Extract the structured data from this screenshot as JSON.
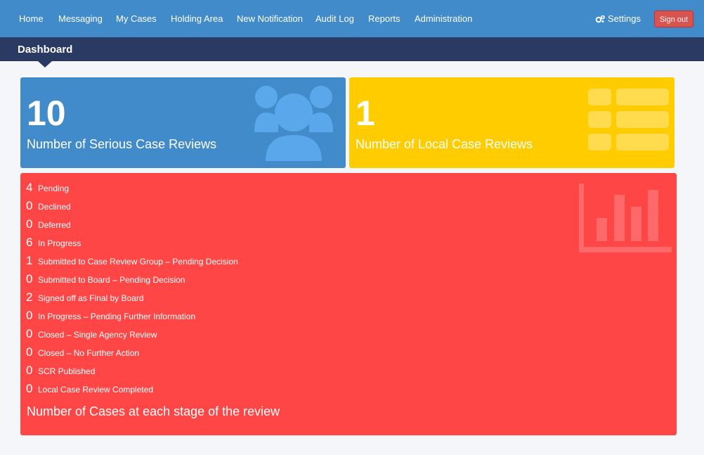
{
  "nav": {
    "items": [
      "Home",
      "Messaging",
      "My Cases",
      "Holding Area",
      "New Notification",
      "Audit Log",
      "Reports",
      "Administration"
    ],
    "settings_label": "Settings",
    "signout_label": "Sign out"
  },
  "header": {
    "title": "Dashboard"
  },
  "cards": {
    "serious": {
      "value": "10",
      "label": "Number of Serious Case Reviews",
      "icon": "users-icon",
      "color": "#428bca"
    },
    "local": {
      "value": "1",
      "label": "Number of Local Case Reviews",
      "icon": "list-icon",
      "color": "#ffcc00"
    }
  },
  "stages": {
    "label": "Number of Cases at each stage of the review",
    "icon": "bar-chart-icon",
    "color": "#ff4646",
    "items": [
      {
        "count": "4",
        "label": "Pending"
      },
      {
        "count": "0",
        "label": "Declined"
      },
      {
        "count": "0",
        "label": "Deferred"
      },
      {
        "count": "6",
        "label": "In Progress"
      },
      {
        "count": "1",
        "label": "Submitted to Case Review Group – Pending Decision"
      },
      {
        "count": "0",
        "label": "Submitted to Board – Pending Decision"
      },
      {
        "count": "2",
        "label": "Signed off as Final by Board"
      },
      {
        "count": "0",
        "label": "In Progress – Pending Further Information"
      },
      {
        "count": "0",
        "label": "Closed – Single Agency Review"
      },
      {
        "count": "0",
        "label": "Closed – No Further Action"
      },
      {
        "count": "0",
        "label": "SCR Published"
      },
      {
        "count": "0",
        "label": "Local Case Review Completed"
      }
    ]
  }
}
